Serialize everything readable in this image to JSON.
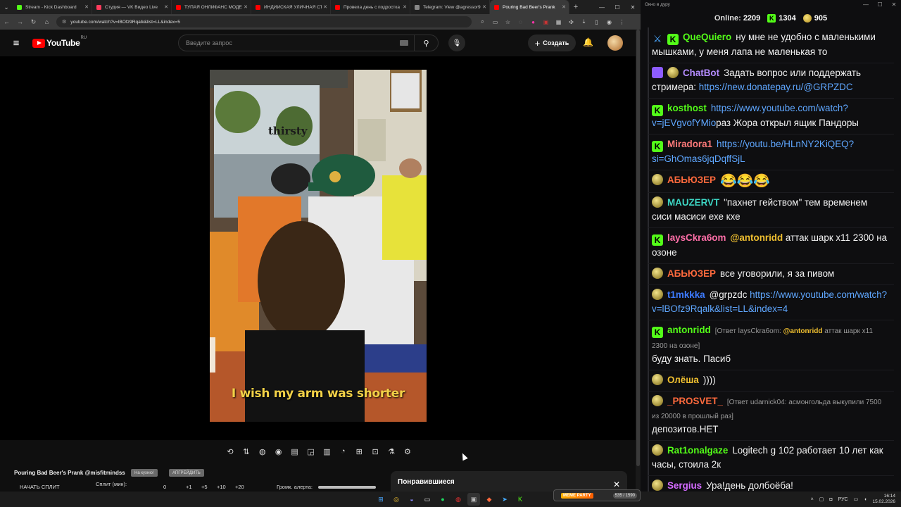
{
  "browser": {
    "tabs": [
      {
        "label": "Stream - Kick Dashboard",
        "color": "#53fc18",
        "active": false
      },
      {
        "label": "Студия — VK Видео Live",
        "color": "#ff3b5c",
        "active": false
      },
      {
        "label": "ТУПАЯ ОНЛИФАНС МОДЕЛЬ",
        "color": "#ff0000",
        "active": false
      },
      {
        "label": "ИНДИЙСКАЯ УЛИЧНАЯ СТ",
        "color": "#ff0000",
        "active": false
      },
      {
        "label": "Провела день с подростка",
        "color": "#ff0000",
        "active": false
      },
      {
        "label": "Telegram: View @agressor9",
        "color": "#888888",
        "active": false
      },
      {
        "label": "Pouring Bad Beer's Prank",
        "color": "#ff0000",
        "active": true
      }
    ],
    "url": "youtube.com/watch?v=lBOfz9Rqalk&list=LL&index=5"
  },
  "youtube": {
    "logo_text": "YouTube",
    "logo_region": "RU",
    "search_placeholder": "Введите запрос",
    "create_label": "Создать",
    "video_overlay_text": "thirsty",
    "video_caption": "I wish my arm was shorter",
    "video_title": "Pouring Bad Beer's Prank @misfitmindss",
    "chip_1": "На кухню!",
    "chip_2": "АПГРЕЙДИТЬ",
    "split_label": "НАЧАТЬ СПЛИТ",
    "split_min_label": "Сплит (мин):",
    "split_values": [
      "0",
      "+1",
      "+5",
      "+10",
      "+20"
    ],
    "volume_label": "Громк. алерта:",
    "liked_panel_title": "Понравившиеся"
  },
  "chat": {
    "window_title": "Окно в дуру",
    "online_label": "Online:",
    "online_count": "2209",
    "kick_count": "1304",
    "other_count": "905",
    "messages": [
      {
        "badges": [
          "mod",
          "kick"
        ],
        "user": "QueQuiero",
        "color": "#53fc18",
        "parts": [
          {
            "t": "ну мне не удобно с маленькими мышками, у меня лапа не маленькая то"
          }
        ]
      },
      {
        "badges": [
          "bot",
          "beer"
        ],
        "user": "ChatBot",
        "color": "#b48cff",
        "parts": [
          {
            "t": "Задать вопрос или поддержать стримера: "
          },
          {
            "t": "https://new.donatepay.ru/@GRPZDC",
            "k": "link"
          }
        ]
      },
      {
        "badges": [
          "kick"
        ],
        "user": "kosthost",
        "color": "#53fc18",
        "parts": [
          {
            "t": "https://www.youtube.com/watch?v=jEVgvofYMio",
            "k": "link"
          },
          {
            "t": "раз Жора открыл ящик Пандоры"
          }
        ]
      },
      {
        "badges": [
          "kick"
        ],
        "user": "Miradora1",
        "color": "#ff7a7a",
        "parts": [
          {
            "t": "https://youtu.be/HLnNY2KiQEQ?si=GhOmas6jqDqffSjL",
            "k": "link"
          }
        ]
      },
      {
        "badges": [
          "beer"
        ],
        "user": "АБЬЮЗЕР",
        "color": "#ff6a3d",
        "parts": [
          {
            "t": "😂😂😂",
            "k": "emo"
          }
        ]
      },
      {
        "badges": [
          "beer"
        ],
        "user": "MAUZERVT",
        "color": "#3dd6c4",
        "parts": [
          {
            "t": "\"пахнет гейством\" тем временем сиси масиси ехе кхе"
          }
        ]
      },
      {
        "badges": [
          "kick"
        ],
        "user": "laysCkra6om",
        "color": "#ff6fa8",
        "parts": [
          {
            "t": "@antonridd",
            "k": "mention"
          },
          {
            "t": " аттак шарк х11 2300 на озоне"
          }
        ]
      },
      {
        "badges": [
          "beer"
        ],
        "user": "АБЬЮЗЕР",
        "color": "#ff6a3d",
        "parts": [
          {
            "t": "все уговорили, я за пивом"
          }
        ]
      },
      {
        "badges": [
          "beer"
        ],
        "user": "t1mkkka",
        "color": "#3d7bff",
        "parts": [
          {
            "t": "@grpzdc "
          },
          {
            "t": "https://www.youtube.com/watch?v=lBOfz9Rqalk&list=LL&index=4",
            "k": "link"
          }
        ]
      },
      {
        "badges": [
          "kick"
        ],
        "user": "antonridd",
        "color": "#53fc18",
        "reply": "[Ответ laysCkra6om: ",
        "reply_mention": "@antonridd",
        "reply_rest": " аттак шарк х11 2300 на озоне]",
        "parts": [
          {
            "t": "буду знать. Пасиб"
          }
        ]
      },
      {
        "badges": [
          "beer"
        ],
        "user": "Олёша",
        "color": "#f0c030",
        "parts": [
          {
            "t": "))))"
          }
        ]
      },
      {
        "badges": [
          "beer"
        ],
        "user": "_PROSVET_",
        "color": "#ff6a3d",
        "reply": "[Ответ udarnick04: асмонгольда выкупили 7500 из 20000 в прошлый раз]",
        "parts": [
          {
            "t": "депозитов.НЕТ"
          }
        ]
      },
      {
        "badges": [
          "beer"
        ],
        "user": "Rat1onalgaze",
        "color": "#53fc18",
        "parts": [
          {
            "t": "Logitech g 102 работает 10 лет как часы, стоила 2к"
          }
        ]
      },
      {
        "badges": [
          "beer"
        ],
        "user": "Sergius",
        "color": "#d36bff",
        "parts": [
          {
            "t": "Ура!день долбоёба!"
          }
        ]
      }
    ]
  },
  "taskbar": {
    "meme_label": "MEME PARTY",
    "meme_count": "535 / 1590",
    "lang": "РУС",
    "time": "16:14",
    "date": "15.02.2026"
  }
}
